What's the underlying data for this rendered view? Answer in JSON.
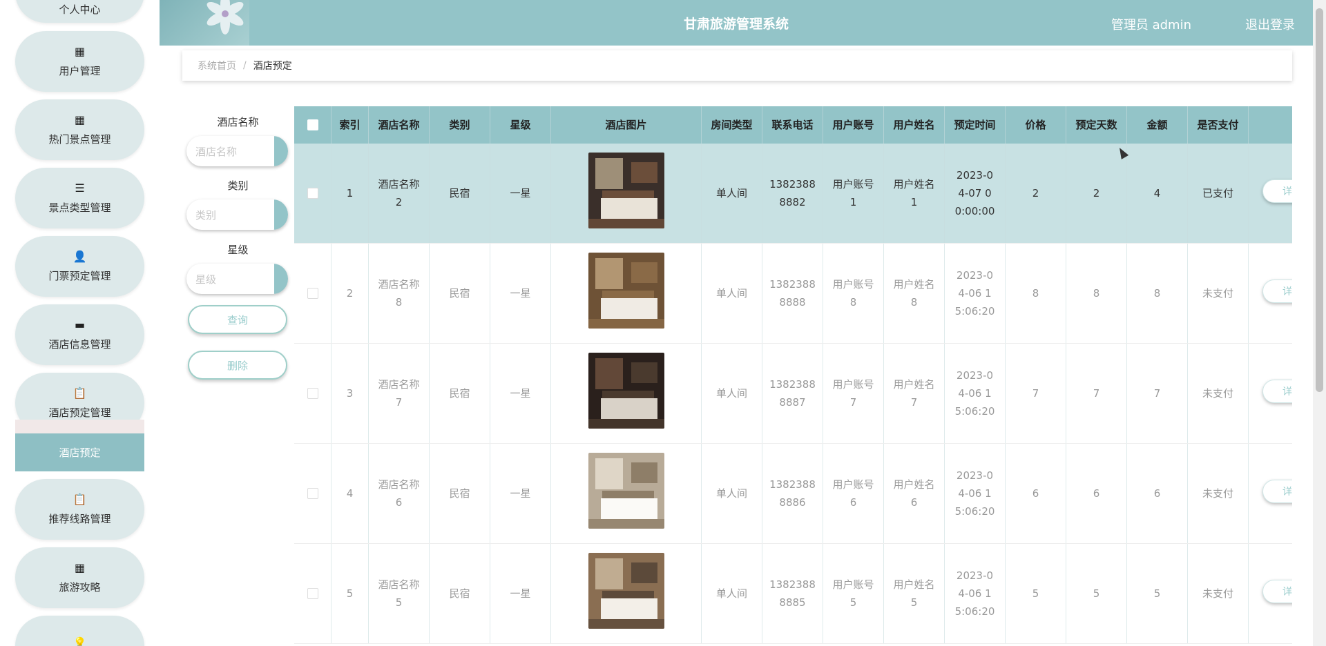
{
  "sidebar": {
    "top_cut_label": "个人中心",
    "items": [
      {
        "label": "用户管理",
        "icon": "grid-icon",
        "glyph": "▦"
      },
      {
        "label": "热门景点管理",
        "icon": "grid-icon",
        "glyph": "▦"
      },
      {
        "label": "景点类型管理",
        "icon": "list-icon",
        "glyph": "☰"
      },
      {
        "label": "门票预定管理",
        "icon": "user-icon",
        "glyph": "👤"
      },
      {
        "label": "酒店信息管理",
        "icon": "monitor-icon",
        "glyph": "▬"
      },
      {
        "label": "酒店预定管理",
        "icon": "clipboard-x-icon",
        "glyph": "📋"
      },
      {
        "label": "推荐线路管理",
        "icon": "clipboard-check-icon",
        "glyph": "📋"
      },
      {
        "label": "旅游攻略",
        "icon": "grid-icon",
        "glyph": "▦"
      },
      {
        "label": "",
        "icon": "bulb-icon",
        "glyph": "💡"
      }
    ],
    "active_sub": "酒店预定"
  },
  "header": {
    "title": "甘肃旅游管理系统",
    "user": "管理员 admin",
    "logout": "退出登录"
  },
  "breadcrumb": {
    "home": "系统首页",
    "separator": "/",
    "current": "酒店预定"
  },
  "search": {
    "hotel_label": "酒店名称",
    "hotel_placeholder": "酒店名称",
    "type_label": "类别",
    "type_placeholder": "类别",
    "star_label": "星级",
    "star_placeholder": "星级",
    "query_button": "查询",
    "delete_button": "删除"
  },
  "table": {
    "headers": [
      "索引",
      "酒店名称",
      "类别",
      "星级",
      "酒店图片",
      "房间类型",
      "联系电话",
      "用户账号",
      "用户姓名",
      "预定时间",
      "价格",
      "预定天数",
      "金额",
      "是否支付"
    ],
    "rows": [
      {
        "index": "1",
        "hotel": "酒店名称2",
        "type": "民宿",
        "star": "一星",
        "room": "单人间",
        "phone": "13823888882",
        "account": "用户账号1",
        "name": "用户姓名1",
        "time": "2023-04-07 00:00:00",
        "price": "2",
        "days": "2",
        "amount": "4",
        "paid": "已支付",
        "detail": "详"
      },
      {
        "index": "2",
        "hotel": "酒店名称8",
        "type": "民宿",
        "star": "一星",
        "room": "单人间",
        "phone": "13823888888",
        "account": "用户账号8",
        "name": "用户姓名8",
        "time": "2023-04-06 15:06:20",
        "price": "8",
        "days": "8",
        "amount": "8",
        "paid": "未支付",
        "detail": "详"
      },
      {
        "index": "3",
        "hotel": "酒店名称7",
        "type": "民宿",
        "star": "一星",
        "room": "单人间",
        "phone": "13823888887",
        "account": "用户账号7",
        "name": "用户姓名7",
        "time": "2023-04-06 15:06:20",
        "price": "7",
        "days": "7",
        "amount": "7",
        "paid": "未支付",
        "detail": "详"
      },
      {
        "index": "4",
        "hotel": "酒店名称6",
        "type": "民宿",
        "star": "一星",
        "room": "单人间",
        "phone": "13823888886",
        "account": "用户账号6",
        "name": "用户姓名6",
        "time": "2023-04-06 15:06:20",
        "price": "6",
        "days": "6",
        "amount": "6",
        "paid": "未支付",
        "detail": "详"
      },
      {
        "index": "5",
        "hotel": "酒店名称5",
        "type": "民宿",
        "star": "一星",
        "room": "单人间",
        "phone": "13823888885",
        "account": "用户账号5",
        "name": "用户姓名5",
        "time": "2023-04-06 15:06:20",
        "price": "5",
        "days": "5",
        "amount": "5",
        "paid": "未支付",
        "detail": "详"
      }
    ]
  },
  "colors": {
    "accent": "#93c4c8",
    "sidebar_item": "#dde9ea",
    "selected_row": "#c8e1e3"
  }
}
